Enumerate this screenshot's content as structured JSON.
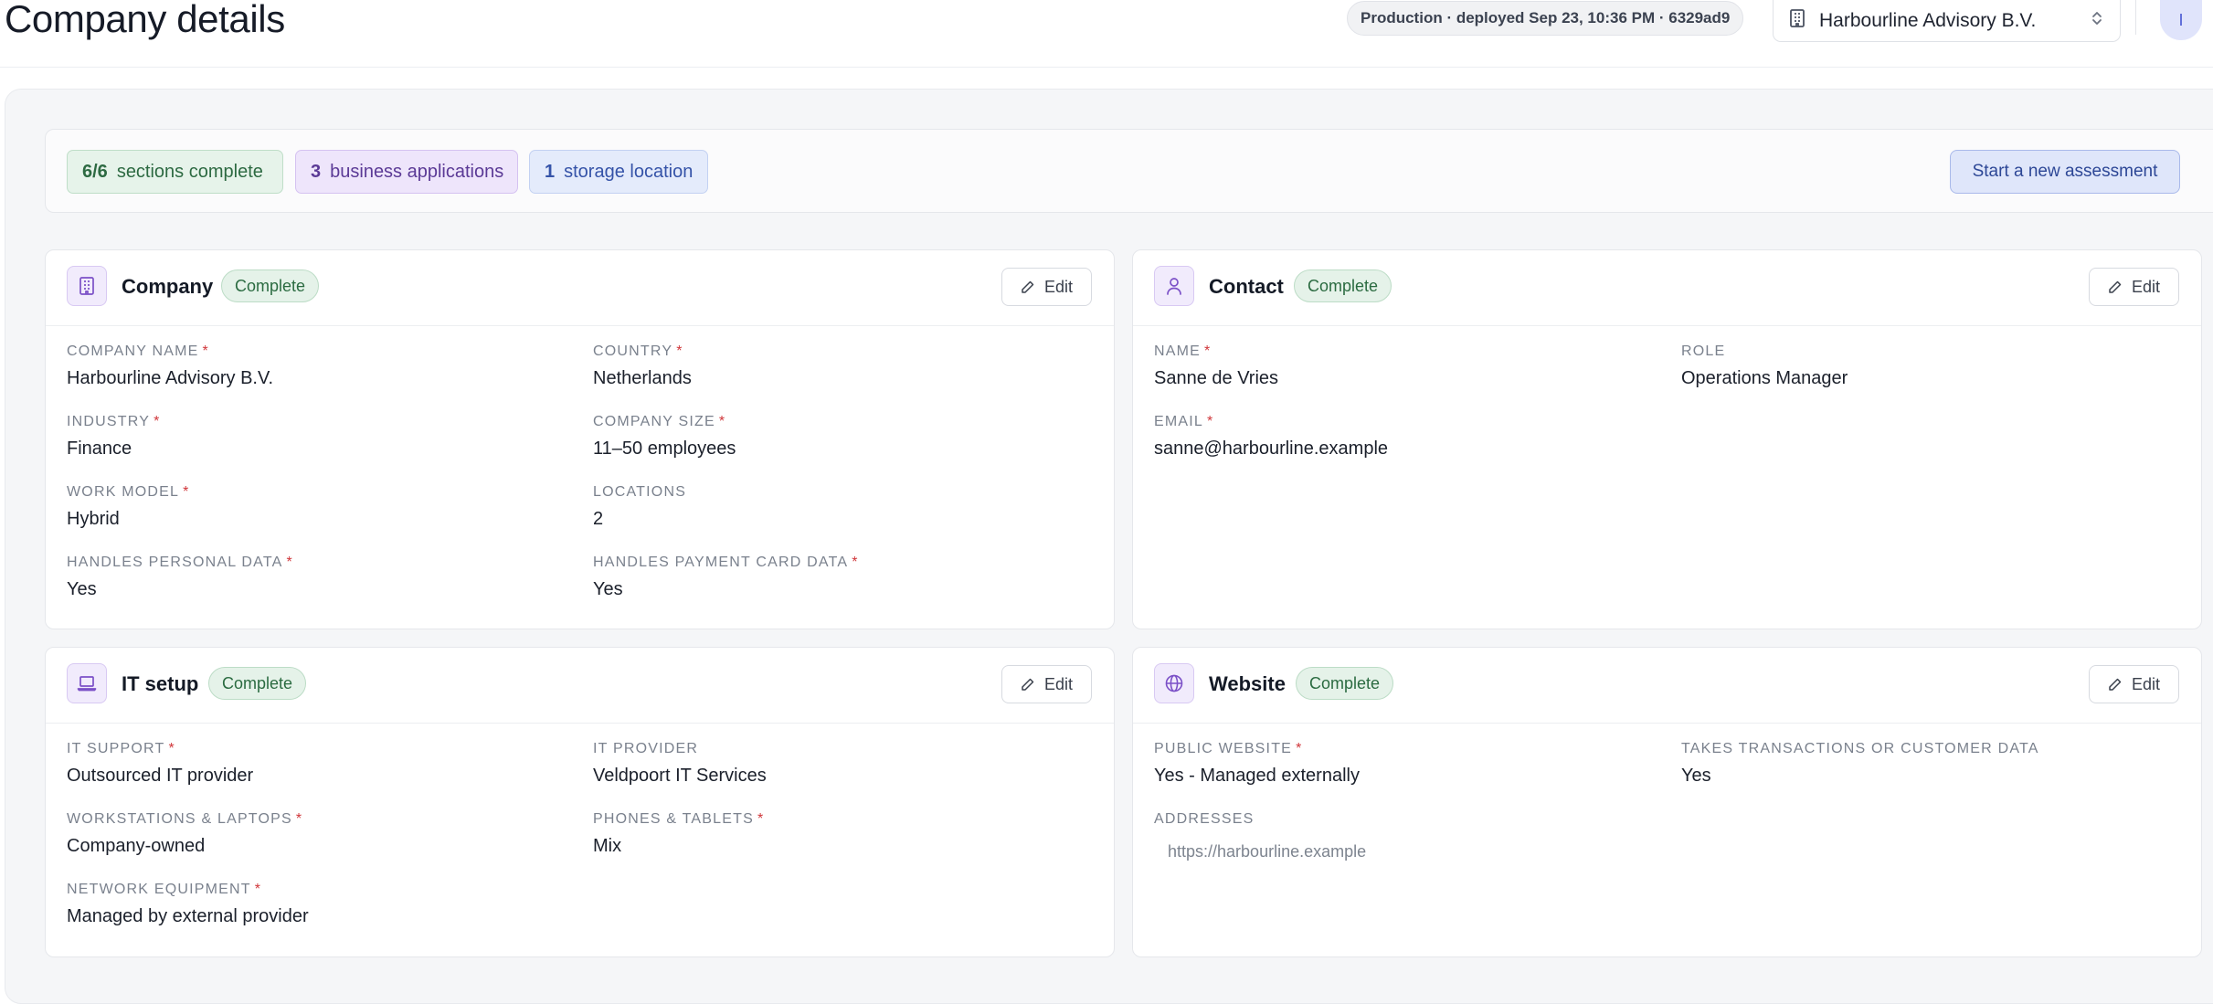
{
  "header": {
    "title": "Company details",
    "deploy_badge": "Production · deployed Sep 23, 10:36 PM · 6329ad9",
    "org_selector": "Harbourline Advisory B.V.",
    "avatar_initial": "I"
  },
  "summary": {
    "sections_count": "6/6",
    "sections_label": "sections complete",
    "apps_count": "3",
    "apps_label": "business applications",
    "storage_count": "1",
    "storage_label": "storage location",
    "new_assessment_label": "Start a new assessment"
  },
  "labels": {
    "edit": "Edit",
    "required": "*"
  },
  "colors": {
    "accent": "#4c5bd4",
    "complete_bg": "#e5f2e9",
    "complete_text": "#2b6b41",
    "required": "#d0363a",
    "icon_purple": "#7b50c7"
  },
  "cards": {
    "company": {
      "title": "Company",
      "status": "Complete",
      "icon": "building-icon",
      "fields": [
        {
          "label": "COMPANY NAME",
          "value": "Harbourline Advisory B.V."
        },
        {
          "label": "COUNTRY",
          "value": "Netherlands"
        },
        {
          "label": "INDUSTRY",
          "value": "Finance"
        },
        {
          "label": "COMPANY SIZE",
          "value": "11–50 employees"
        },
        {
          "label": "WORK MODEL",
          "value": "Hybrid"
        },
        {
          "label": "LOCATIONS",
          "value": "2"
        },
        {
          "label": "HANDLES PERSONAL DATA",
          "value": "Yes"
        },
        {
          "label": "HANDLES PAYMENT CARD DATA",
          "value": "Yes"
        }
      ]
    },
    "contact": {
      "title": "Contact",
      "status": "Complete",
      "icon": "user-icon",
      "fields": [
        {
          "label": "NAME",
          "value": "Sanne de Vries"
        },
        {
          "label": "ROLE",
          "value": "Operations Manager"
        },
        {
          "label": "EMAIL",
          "value": "sanne@harbourline.example"
        }
      ]
    },
    "it_setup": {
      "title": "IT setup",
      "status": "Complete",
      "icon": "laptop-icon",
      "fields": [
        {
          "label": "IT SUPPORT",
          "value": "Outsourced IT provider"
        },
        {
          "label": "IT PROVIDER",
          "value": "Veldpoort IT Services"
        },
        {
          "label": "WORKSTATIONS & LAPTOPS",
          "value": "Company-owned"
        },
        {
          "label": "PHONES & TABLETS",
          "value": "Mix"
        },
        {
          "label": "NETWORK EQUIPMENT",
          "value": "Managed by external provider"
        }
      ]
    },
    "website": {
      "title": "Website",
      "status": "Complete",
      "icon": "globe-icon",
      "fields": [
        {
          "label": "PUBLIC WEBSITE",
          "value": "Yes - Managed externally"
        },
        {
          "label": "TAKES TRANSACTIONS OR CUSTOMER DATA",
          "value": "Yes"
        },
        {
          "label": "ADDRESSES"
        }
      ],
      "addresses": [
        "https://harbourline.example"
      ]
    }
  }
}
